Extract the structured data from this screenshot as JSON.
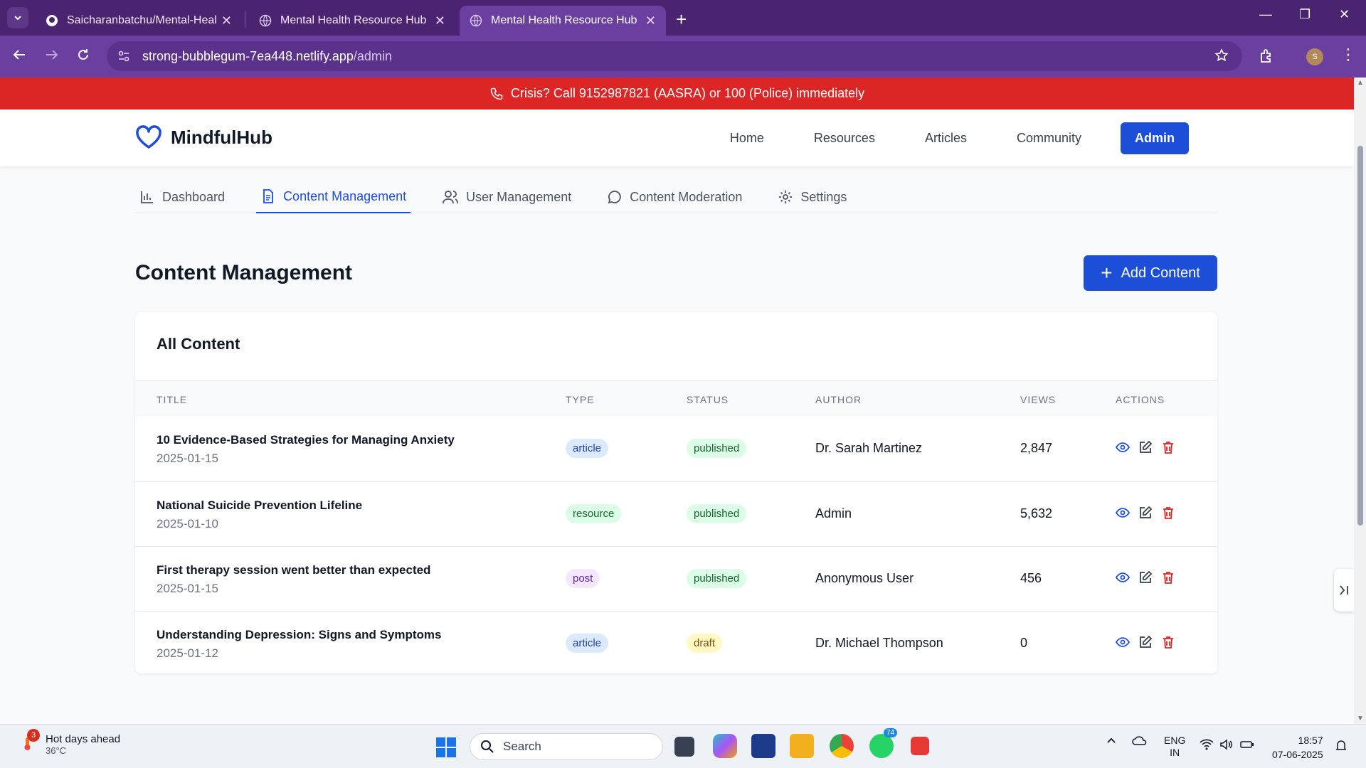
{
  "browser": {
    "tabs": [
      {
        "title": "Saicharanbatchu/Mental-Health"
      },
      {
        "title": "Mental Health Resource Hub - S"
      },
      {
        "title": "Mental Health Resource Hub - S"
      }
    ],
    "url_host": "strong-bubblegum-7ea448.netlify.app",
    "url_path": "/admin",
    "profile_initial": "S"
  },
  "crisis": {
    "text": "Crisis? Call 9152987821 (AASRA) or 100 (Police) immediately"
  },
  "header": {
    "brand": "MindfulHub",
    "nav": [
      {
        "label": "Home"
      },
      {
        "label": "Resources"
      },
      {
        "label": "Articles"
      },
      {
        "label": "Community"
      }
    ],
    "admin_label": "Admin"
  },
  "admin_tabs": [
    {
      "label": "Dashboard",
      "icon": "bar-chart-icon"
    },
    {
      "label": "Content Management",
      "icon": "document-icon"
    },
    {
      "label": "User Management",
      "icon": "users-icon"
    },
    {
      "label": "Content Moderation",
      "icon": "message-circle-icon"
    },
    {
      "label": "Settings",
      "icon": "gear-icon"
    }
  ],
  "main": {
    "title": "Content Management",
    "add_label": "Add Content"
  },
  "table": {
    "heading": "All Content",
    "columns": [
      "TITLE",
      "TYPE",
      "STATUS",
      "AUTHOR",
      "VIEWS",
      "ACTIONS"
    ],
    "rows": [
      {
        "title": "10 Evidence-Based Strategies for Managing Anxiety",
        "date": "2025-01-15",
        "type": "article",
        "status": "published",
        "author": "Dr. Sarah Martinez",
        "views": "2,847"
      },
      {
        "title": "National Suicide Prevention Lifeline",
        "date": "2025-01-10",
        "type": "resource",
        "status": "published",
        "author": "Admin",
        "views": "5,632"
      },
      {
        "title": "First therapy session went better than expected",
        "date": "2025-01-15",
        "type": "post",
        "status": "published",
        "author": "Anonymous User",
        "views": "456"
      },
      {
        "title": "Understanding Depression: Signs and Symptoms",
        "date": "2025-01-12",
        "type": "article",
        "status": "draft",
        "author": "Dr. Michael Thompson",
        "views": "0"
      }
    ]
  },
  "taskbar": {
    "weather_title": "Hot days ahead",
    "weather_temp": "36°C",
    "weather_badge": "3",
    "search_placeholder": "Search",
    "lang_top": "ENG",
    "lang_bottom": "IN",
    "time": "18:57",
    "date": "07-06-2025",
    "whatsapp_badge": "74"
  },
  "colors": {
    "primary": "#1d4ed8",
    "crisis": "#dc2626",
    "delete": "#dc2626",
    "browser": "#6b3fa0"
  }
}
